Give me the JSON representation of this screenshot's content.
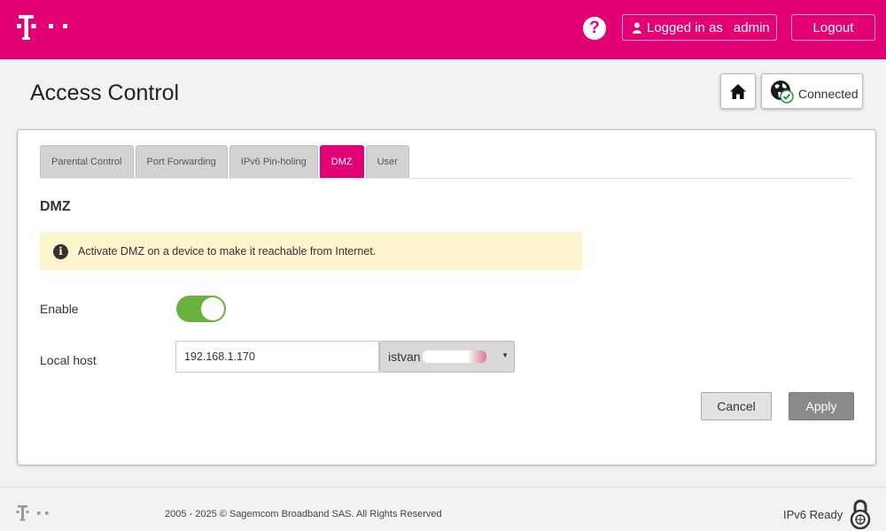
{
  "header": {
    "brand_color": "#e20074",
    "help_icon": "question-mark-icon",
    "help_label": "?",
    "logged_in_label": "Logged in as",
    "username": "admin",
    "logout_label": "Logout"
  },
  "title_row": {
    "page_title": "Access Control",
    "home_icon": "home-icon",
    "connection_status": "Connected"
  },
  "tabs": [
    {
      "label": "Parental Control",
      "active": false
    },
    {
      "label": "Port Forwarding",
      "active": false
    },
    {
      "label": "IPv6 Pin-holing",
      "active": false
    },
    {
      "label": "DMZ",
      "active": true
    },
    {
      "label": "User",
      "active": false
    }
  ],
  "dmz": {
    "section_title": "DMZ",
    "info_text": "Activate DMZ on a device to make it reachable from Internet.",
    "enable_label": "Enable",
    "enable_value": true,
    "local_host_label": "Local host",
    "local_host_ip": "192.168.1.170",
    "local_host_device": "istvan",
    "cancel_label": "Cancel",
    "apply_label": "Apply"
  },
  "footer": {
    "copyright": "2005 - 2025 © Sagemcom Broadband SAS. All Rights Reserved",
    "ipv6_label": "IPv6 Ready"
  },
  "colors": {
    "accent": "#e20074",
    "toggle_on": "#6bb13e",
    "info_bg": "#fdf3cc"
  }
}
